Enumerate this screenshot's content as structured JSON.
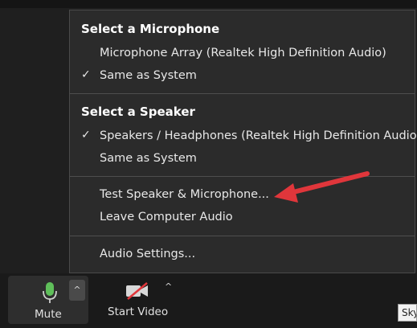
{
  "menu": {
    "microphone_header": "Select a Microphone",
    "microphone_items": [
      {
        "label": "Microphone Array (Realtek High Definition Audio)",
        "checked": false
      },
      {
        "label": "Same as System",
        "checked": true
      }
    ],
    "speaker_header": "Select a Speaker",
    "speaker_items": [
      {
        "label": "Speakers / Headphones (Realtek High Definition Audio)",
        "checked": true
      },
      {
        "label": "Same as System",
        "checked": false
      }
    ],
    "test_label": "Test Speaker & Microphone...",
    "leave_label": "Leave Computer Audio",
    "settings_label": "Audio Settings...",
    "check_glyph": "✓"
  },
  "toolbar": {
    "mute_label": "Mute",
    "start_video_label": "Start Video",
    "caret_glyph": "^"
  },
  "tooltip": {
    "text": "Sky"
  },
  "colors": {
    "arrow": "#e0363b",
    "mic_green": "#5fbf5a",
    "video_slash_red": "#e0363b"
  },
  "icons": {
    "mic": "microphone-icon",
    "video": "video-camera-off-icon",
    "arrow": "red-arrow-annotation"
  }
}
